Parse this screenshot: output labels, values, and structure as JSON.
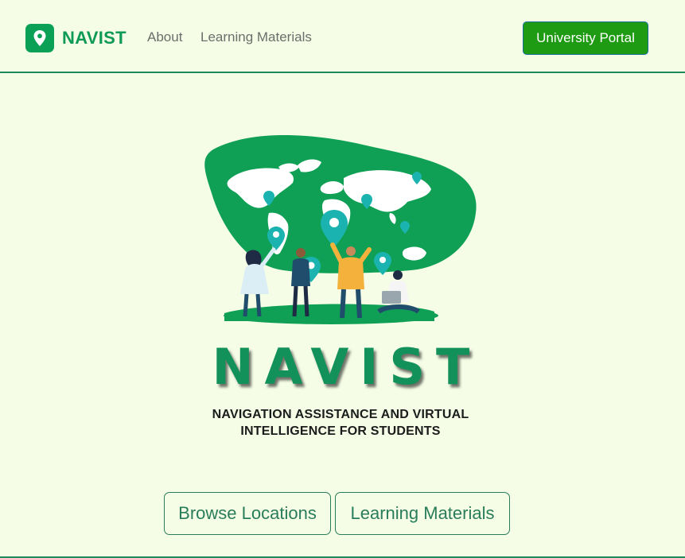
{
  "navbar": {
    "brand": {
      "icon": "map-pin-icon",
      "name": "NAVIST",
      "color": "#0d9a55"
    },
    "links": [
      {
        "label": "About"
      },
      {
        "label": "Learning Materials"
      }
    ],
    "portal_button": {
      "label": "University Portal",
      "color": "#1e9b12"
    }
  },
  "hero": {
    "illustration": "world-map-people-pins-illustration",
    "title": "NAVIST",
    "subtitle_line1": "NAVIGATION ASSISTANCE AND VIRTUAL",
    "subtitle_line2": "INTELLIGENCE FOR STUDENTS",
    "buttons": [
      {
        "label": "Browse Locations"
      },
      {
        "label": "Learning Materials"
      }
    ]
  },
  "colors": {
    "background": "#f5fde6",
    "accent": "#12915a",
    "blob": "#0fa055",
    "outline": "#2a7d5a"
  }
}
